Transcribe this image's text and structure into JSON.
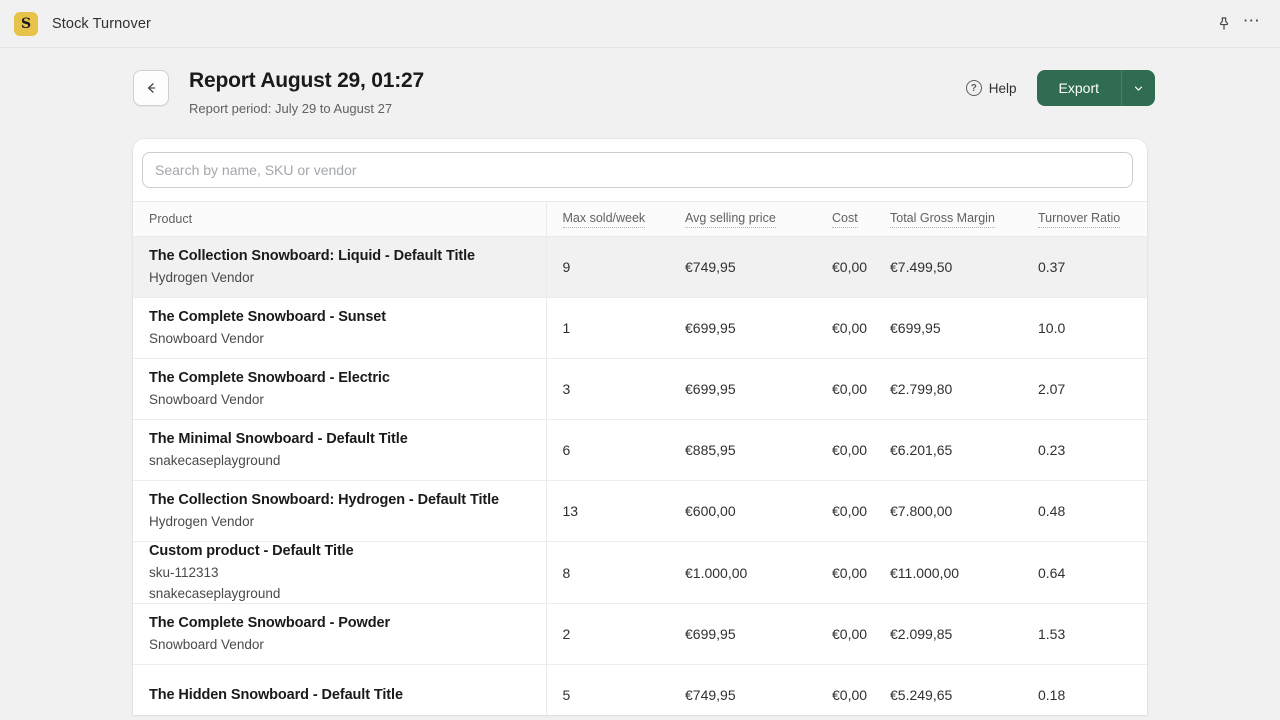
{
  "appbar": {
    "logo_letter": "S",
    "title": "Stock Turnover",
    "pin_icon": "pin-icon",
    "more_icon": "more-horizontal-icon"
  },
  "header": {
    "back_icon": "arrow-left-icon",
    "title": "Report August 29, 01:27",
    "subtitle": "Report period: July 29 to August 27",
    "help_label": "Help",
    "help_icon_glyph": "?",
    "export_label": "Export",
    "export_caret_glyph": "⌄",
    "accent_color": "#2f6c51"
  },
  "search": {
    "placeholder": "Search by name, SKU or vendor",
    "value": ""
  },
  "table": {
    "columns": [
      {
        "key": "product",
        "label": "Product",
        "dotted": false
      },
      {
        "key": "max_sold",
        "label": "Max sold/week",
        "dotted": true
      },
      {
        "key": "avg_price",
        "label": "Avg selling price",
        "dotted": true
      },
      {
        "key": "cost",
        "label": "Cost",
        "dotted": true
      },
      {
        "key": "margin",
        "label": "Total Gross Margin",
        "dotted": true
      },
      {
        "key": "ratio",
        "label": "Turnover Ratio",
        "dotted": true
      }
    ],
    "rows": [
      {
        "title": "The Collection Snowboard: Liquid - Default Title",
        "sku": "",
        "vendor": "Hydrogen Vendor",
        "max_sold": "9",
        "avg_price": "€749,95",
        "cost": "€0,00",
        "margin": "€7.499,50",
        "ratio": "0.37",
        "highlighted": true
      },
      {
        "title": "The Complete Snowboard - Sunset",
        "sku": "",
        "vendor": "Snowboard Vendor",
        "max_sold": "1",
        "avg_price": "€699,95",
        "cost": "€0,00",
        "margin": "€699,95",
        "ratio": "10.0",
        "highlighted": false
      },
      {
        "title": "The Complete Snowboard - Electric",
        "sku": "",
        "vendor": "Snowboard Vendor",
        "max_sold": "3",
        "avg_price": "€699,95",
        "cost": "€0,00",
        "margin": "€2.799,80",
        "ratio": "2.07",
        "highlighted": false
      },
      {
        "title": "The Minimal Snowboard - Default Title",
        "sku": "",
        "vendor": "snakecaseplayground",
        "max_sold": "6",
        "avg_price": "€885,95",
        "cost": "€0,00",
        "margin": "€6.201,65",
        "ratio": "0.23",
        "highlighted": false
      },
      {
        "title": "The Collection Snowboard: Hydrogen - Default Title",
        "sku": "",
        "vendor": "Hydrogen Vendor",
        "max_sold": "13",
        "avg_price": "€600,00",
        "cost": "€0,00",
        "margin": "€7.800,00",
        "ratio": "0.48",
        "highlighted": false
      },
      {
        "title": "Custom product - Default Title",
        "sku": "sku-112313",
        "vendor": "snakecaseplayground",
        "max_sold": "8",
        "avg_price": "€1.000,00",
        "cost": "€0,00",
        "margin": "€11.000,00",
        "ratio": "0.64",
        "highlighted": false
      },
      {
        "title": "The Complete Snowboard - Powder",
        "sku": "",
        "vendor": "Snowboard Vendor",
        "max_sold": "2",
        "avg_price": "€699,95",
        "cost": "€0,00",
        "margin": "€2.099,85",
        "ratio": "1.53",
        "highlighted": false
      },
      {
        "title": "The Hidden Snowboard - Default Title",
        "sku": "",
        "vendor": "",
        "max_sold": "5",
        "avg_price": "€749,95",
        "cost": "€0,00",
        "margin": "€5.249,65",
        "ratio": "0.18",
        "highlighted": false
      }
    ]
  }
}
